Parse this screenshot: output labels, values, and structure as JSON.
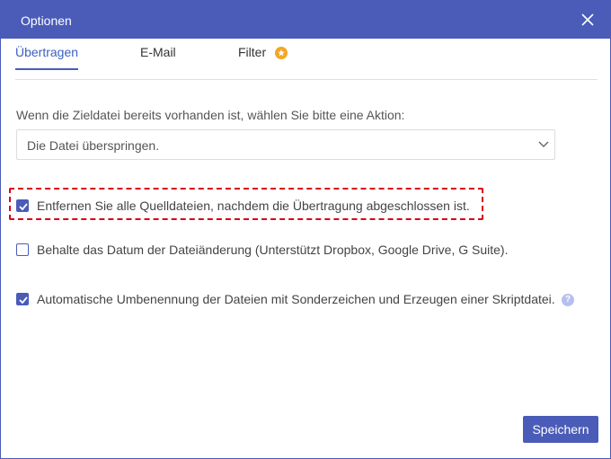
{
  "window": {
    "title": "Optionen"
  },
  "tabs": [
    {
      "label": "Übertragen",
      "active": true
    },
    {
      "label": "E-Mail",
      "active": false
    },
    {
      "label": "Filter",
      "active": false
    }
  ],
  "conflict": {
    "label": "Wenn die Zieldatei bereits vorhanden ist, wählen Sie bitte eine Aktion:",
    "selected": "Die Datei überspringen."
  },
  "options": [
    {
      "label": "Entfernen Sie alle Quelldateien, nachdem die Übertragung abgeschlossen ist.",
      "checked": true
    },
    {
      "label": "Behalte das Datum der Dateiänderung (Unterstützt Dropbox, Google Drive, G Suite).",
      "checked": false
    },
    {
      "label": "Automatische Umbenennung der Dateien mit Sonderzeichen und Erzeugen einer Skriptdatei.",
      "checked": true
    }
  ],
  "icons": {
    "close": "close-icon",
    "filter_badge": "star-icon",
    "dropdown": "chevron-down-icon",
    "help": "question-icon"
  },
  "help_glyph": "?",
  "colors": {
    "accent": "#4a5cb8",
    "highlight": "#d9001b",
    "badge": "#f5a623"
  },
  "footer": {
    "save_label": "Speichern"
  }
}
